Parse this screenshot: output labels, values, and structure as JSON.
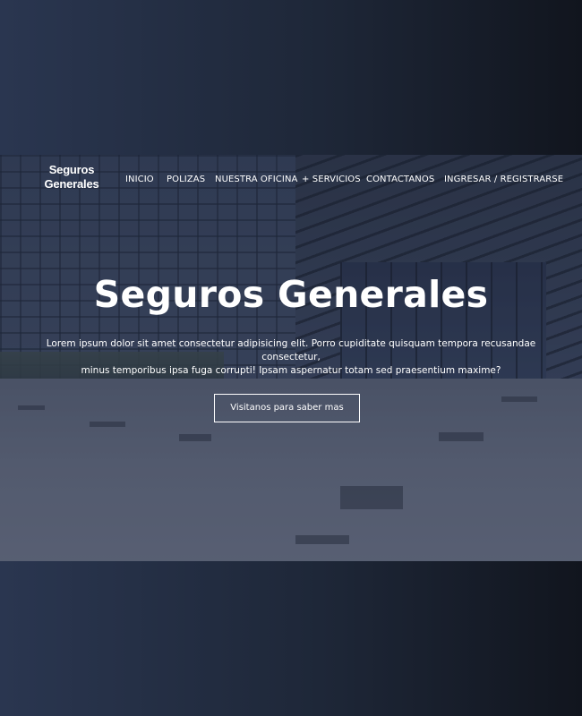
{
  "brand": {
    "line1": "Seguros",
    "line2": "Generales"
  },
  "nav": {
    "items": [
      {
        "label": "INICIO"
      },
      {
        "label": "POLIZAS"
      },
      {
        "label": "NUESTRA OFICINA"
      },
      {
        "label": "+ SERVICIOS"
      },
      {
        "label": "CONTACTANOS"
      },
      {
        "label": "INGRESAR / REGISTRARSE"
      }
    ]
  },
  "hero": {
    "title": "Seguros Generales",
    "description_line1": "Lorem ipsum dolor sit amet consectetur adipisicing elit. Porro cupiditate quisquam tempora recusandae consectetur,",
    "description_line2": "minus temporibus ipsa fuga corrupti! Ipsam aspernatur totam sed praesentium maxime?",
    "cta_label": "Visitanos para saber mas"
  },
  "colors": {
    "page_background": "#1e2738",
    "text": "#ffffff"
  }
}
